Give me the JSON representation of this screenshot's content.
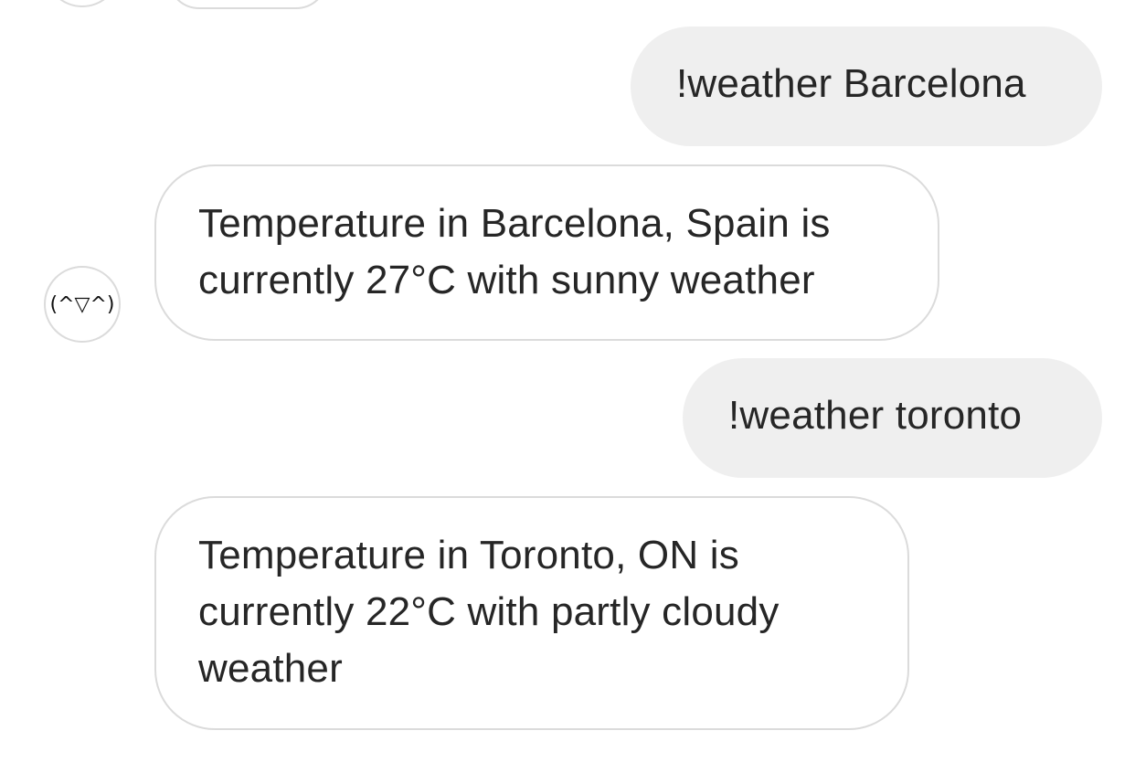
{
  "conversation": {
    "bot_avatar_text": "(^▽^)",
    "messages": [
      {
        "sender": "user",
        "text": "!weather Barcelona"
      },
      {
        "sender": "bot",
        "lines": [
          "Temperature in Barcelona, Spain is",
          "currently 27°C with sunny weather"
        ]
      },
      {
        "sender": "user",
        "text": "!weather toronto"
      },
      {
        "sender": "bot",
        "lines": [
          "Temperature in Toronto, ON is",
          "currently 22°C with partly cloudy",
          "weather"
        ]
      }
    ]
  },
  "colors": {
    "outgoing_bubble": "#efefef",
    "incoming_border": "#dbdbdb",
    "text": "#262626"
  }
}
